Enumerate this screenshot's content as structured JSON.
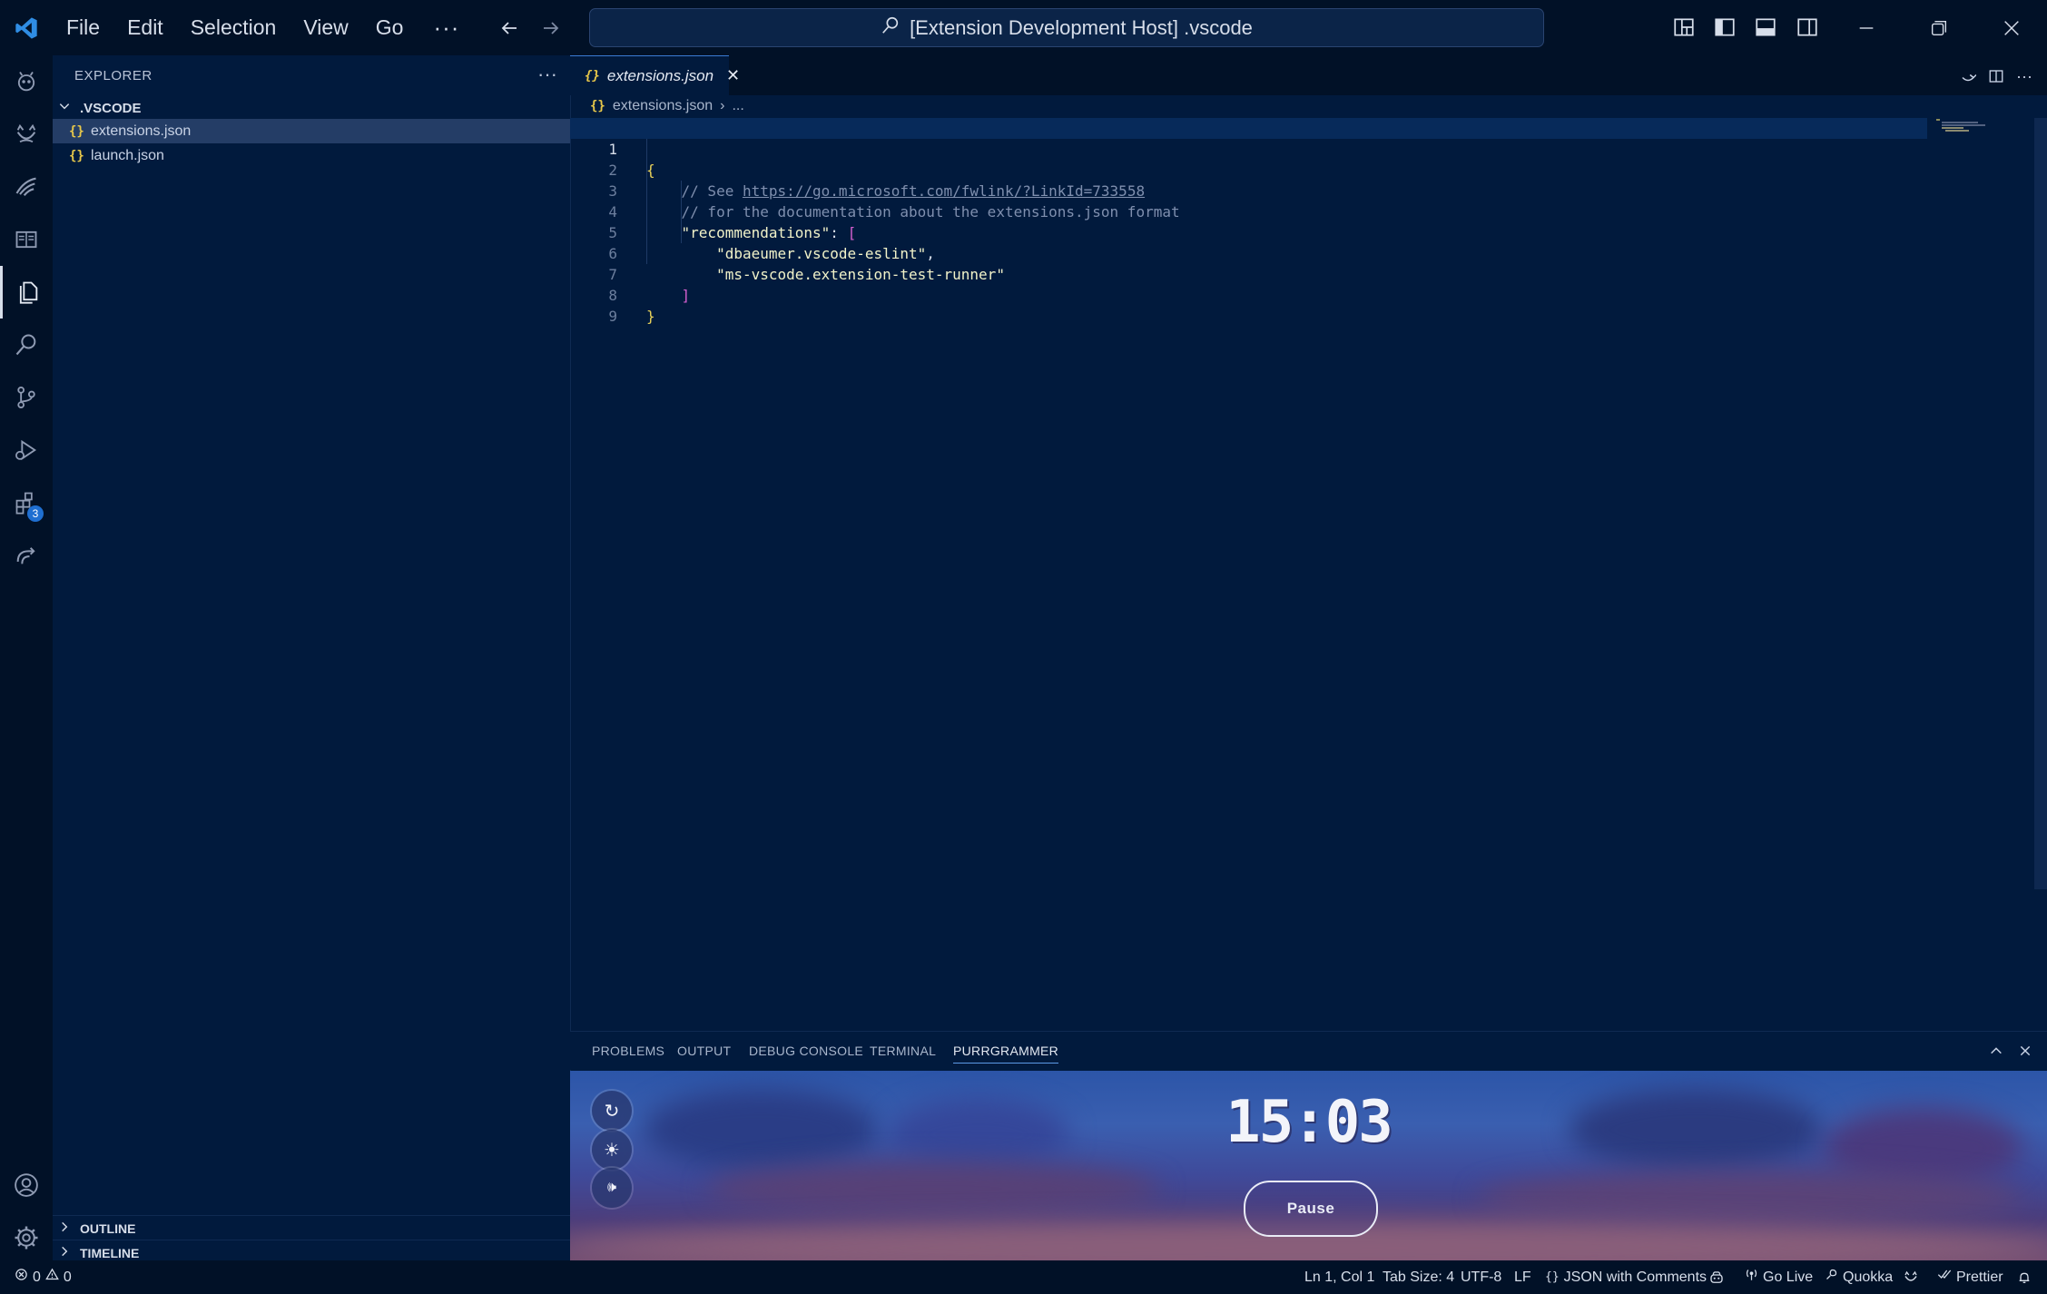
{
  "titlebar": {
    "menu": [
      "File",
      "Edit",
      "Selection",
      "View",
      "Go"
    ],
    "more": "···",
    "search_text": "[Extension Development Host] .vscode"
  },
  "activity": {
    "extensions_badge": "3"
  },
  "sidebar": {
    "title": "EXPLORER",
    "more": "···",
    "folder": ".VSCODE",
    "files": [
      {
        "icon": "{}",
        "name": "extensions.json",
        "selected": true
      },
      {
        "icon": "{}",
        "name": "launch.json",
        "selected": false
      }
    ],
    "sections": [
      "OUTLINE",
      "TIMELINE"
    ]
  },
  "editor": {
    "tab_label": "extensions.json",
    "tab_icon": "{}",
    "breadcrumb": {
      "icon": "{}",
      "file": "extensions.json",
      "sep": "›",
      "rest": "..."
    },
    "line_numbers": [
      "1",
      "2",
      "3",
      "4",
      "5",
      "6",
      "7",
      "8",
      "9"
    ],
    "code": {
      "l1_brace": "{",
      "l2_prefix": "// See ",
      "l2_link": "https://go.microsoft.com/fwlink/?LinkId=733558",
      "l3_comment": "// for the documentation about the extensions.json format",
      "l4_key": "\"recommendations\"",
      "l4_colon": ": ",
      "l4_bracket": "[",
      "l5_str": "\"dbaeumer.vscode-eslint\"",
      "l5_comma": ",",
      "l6_str": "\"ms-vscode.extension-test-runner\"",
      "l7_bracket": "]",
      "l8_brace": "}"
    }
  },
  "panel": {
    "tabs": [
      "PROBLEMS",
      "OUTPUT",
      "DEBUG CONSOLE",
      "TERMINAL",
      "PURRGRAMMER"
    ],
    "active_tab": "PURRGRAMMER",
    "timer": "15:03",
    "pause_label": "Pause",
    "btn_reset": "↻",
    "btn_theme": "☀",
    "btn_sound": "🕪"
  },
  "statusbar": {
    "errors": "0",
    "warnings": "0",
    "position": "Ln 1, Col 1",
    "tab_size": "Tab Size: 4",
    "encoding": "UTF-8",
    "eol": "LF",
    "language": "JSON with Comments",
    "go_live": "Go Live",
    "quokka": "Quokka",
    "prettier": "Prettier"
  },
  "colors": {
    "background": "#011a3d",
    "chrome": "#011127",
    "accent": "#3b7bd4",
    "json_brace": "#e8d25a",
    "json_bracket": "#d55fd0"
  }
}
